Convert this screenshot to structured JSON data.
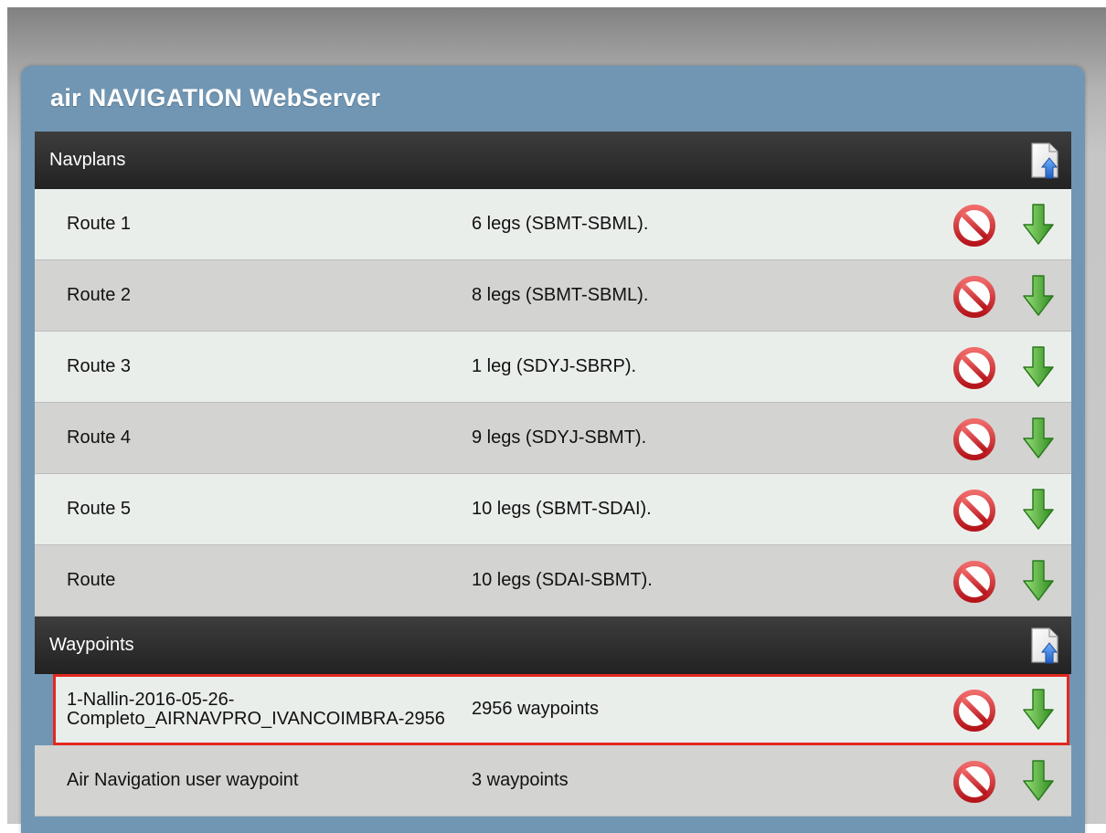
{
  "app": {
    "title": "air NAVIGATION WebServer"
  },
  "colors": {
    "panel": "#7096b3",
    "header": "#2b2b2b",
    "row_light": "#eaeeeb",
    "row_dark": "#d3d3d1",
    "highlight": "#e3281f",
    "delete": "#d02020",
    "download": "#3f9e2a"
  },
  "icons": {
    "upload": "file-upload-icon",
    "delete": "delete-icon",
    "download": "download-arrow-icon"
  },
  "navplans": {
    "header": "Navplans",
    "rows": [
      {
        "name": "Route 1",
        "desc": "6 legs (SBMT-SBML)."
      },
      {
        "name": "Route 2",
        "desc": "8 legs (SBMT-SBML)."
      },
      {
        "name": "Route 3",
        "desc": "1 leg (SDYJ-SBRP)."
      },
      {
        "name": "Route 4",
        "desc": "9 legs (SDYJ-SBMT)."
      },
      {
        "name": "Route 5",
        "desc": "10 legs (SBMT-SDAI)."
      },
      {
        "name": "Route",
        "desc": "10 legs (SDAI-SBMT)."
      }
    ]
  },
  "waypoints": {
    "header": "Waypoints",
    "rows": [
      {
        "name": "1-Nallin-2016-05-26-Completo_AIRNAVPRO_IVANCOIMBRA-2956",
        "desc": "2956 waypoints"
      },
      {
        "name": "Air Navigation user waypoint",
        "desc": "3 waypoints"
      }
    ]
  }
}
